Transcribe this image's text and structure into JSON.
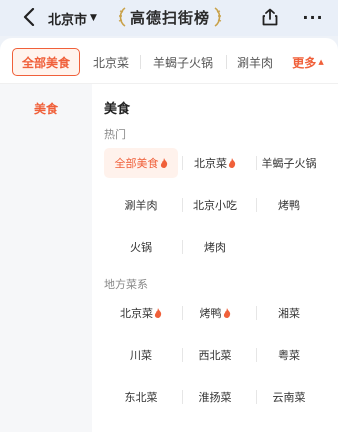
{
  "header": {
    "city": "北京市",
    "brand_title": "高德扫街榜",
    "more_glyph": "···"
  },
  "tabs": [
    {
      "label": "全部美食",
      "active": true
    },
    {
      "label": "北京菜",
      "active": false
    },
    {
      "label": "羊蝎子火锅",
      "active": false
    },
    {
      "label": "涮羊肉",
      "active": false
    }
  ],
  "tabs_more": {
    "label": "更多"
  },
  "sidebar": {
    "items": [
      {
        "label": "美食",
        "active": true
      }
    ]
  },
  "content": {
    "heading": "美食",
    "sections": [
      {
        "label": "热门",
        "items": [
          {
            "label": "全部美食",
            "hot": true,
            "active": true
          },
          {
            "label": "北京菜",
            "hot": true,
            "active": false
          },
          {
            "label": "羊蝎子火锅",
            "hot": false,
            "active": false
          },
          {
            "label": "涮羊肉",
            "hot": false,
            "active": false
          },
          {
            "label": "北京小吃",
            "hot": false,
            "active": false
          },
          {
            "label": "烤鸭",
            "hot": false,
            "active": false
          },
          {
            "label": "火锅",
            "hot": false,
            "active": false
          },
          {
            "label": "烤肉",
            "hot": false,
            "active": false
          }
        ]
      },
      {
        "label": "地方菜系",
        "items": [
          {
            "label": "北京菜",
            "hot": true,
            "active": false
          },
          {
            "label": "烤鸭",
            "hot": true,
            "active": false
          },
          {
            "label": "湘菜",
            "hot": false,
            "active": false
          },
          {
            "label": "川菜",
            "hot": false,
            "active": false
          },
          {
            "label": "西北菜",
            "hot": false,
            "active": false
          },
          {
            "label": "粤菜",
            "hot": false,
            "active": false
          },
          {
            "label": "东北菜",
            "hot": false,
            "active": false
          },
          {
            "label": "淮扬菜",
            "hot": false,
            "active": false
          },
          {
            "label": "云南菜",
            "hot": false,
            "active": false
          }
        ]
      }
    ]
  },
  "colors": {
    "accent": "#f0603a",
    "header_bg": "#e9eff8"
  }
}
